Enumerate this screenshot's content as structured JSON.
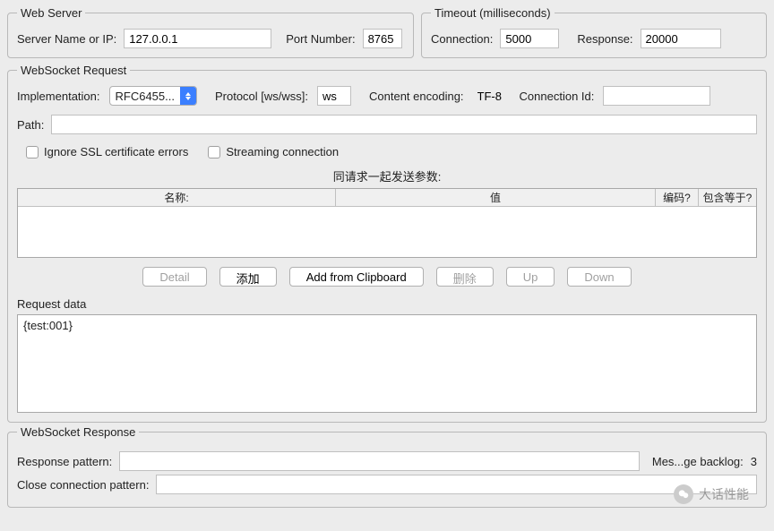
{
  "webServer": {
    "legend": "Web Server",
    "serverLabel": "Server Name or IP:",
    "serverValue": "127.0.0.1",
    "portLabel": "Port Number:",
    "portValue": "8765"
  },
  "timeout": {
    "legend": "Timeout (milliseconds)",
    "connLabel": "Connection:",
    "connValue": "5000",
    "respLabel": "Response:",
    "respValue": "20000"
  },
  "wsReq": {
    "legend": "WebSocket Request",
    "implLabel": "Implementation:",
    "implValue": "RFC6455...",
    "protoLabel": "Protocol [ws/wss]:",
    "protoValue": "ws",
    "encLabel": "Content encoding:",
    "encValue": "TF-8",
    "connIdLabel": "Connection Id:",
    "connIdValue": "",
    "pathLabel": "Path:",
    "pathValue": "",
    "chkSSL": "Ignore SSL certificate errors",
    "chkStream": "Streaming connection",
    "paramsTitle": "同请求一起发送参数:",
    "cols": {
      "name": "名称:",
      "value": "值",
      "enc": "编码?",
      "inc": "包含等于?"
    },
    "btns": {
      "detail": "Detail",
      "add": "添加",
      "clip": "Add from Clipboard",
      "del": "删除",
      "up": "Up",
      "down": "Down"
    },
    "reqDataLabel": "Request data",
    "reqDataValue": "{test:001}"
  },
  "wsResp": {
    "legend": "WebSocket Response",
    "respPatLabel": "Response pattern:",
    "respPatValue": "",
    "backlogLabel": "Mes...ge backlog:",
    "backlogValue": "3",
    "closePatLabel": "Close connection pattern:",
    "closePatValue": ""
  },
  "watermark": "大话性能"
}
